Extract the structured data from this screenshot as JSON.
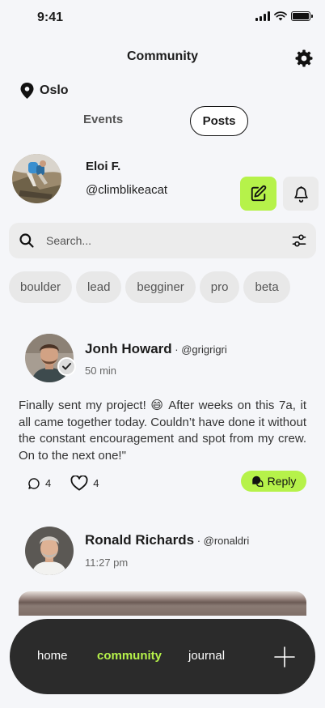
{
  "status": {
    "time": "9:41"
  },
  "header": {
    "title": "Community"
  },
  "location": {
    "city": "Oslo"
  },
  "tabs": {
    "events": "Events",
    "posts": "Posts",
    "active": "posts"
  },
  "profile": {
    "name": "Eloi F.",
    "handle": "@climblikeacat"
  },
  "search": {
    "placeholder": "Search..."
  },
  "chips": [
    "boulder",
    "lead",
    "begginer",
    "pro",
    "beta"
  ],
  "posts": [
    {
      "author": "Jonh Howard",
      "handle": "@grigrigri",
      "time": "50 min",
      "body": "Finally sent my project! 😄 After weeks on this 7a, it all came together today. Couldn’t have done it without the constant encouragement and spot from my crew. On to the next one!\"",
      "comments": "4",
      "likes": "4",
      "reply_label": "Reply"
    },
    {
      "author": "Ronald Richards",
      "handle": "@ronaldri",
      "time": "11:27 pm"
    }
  ],
  "nav": {
    "home": "home",
    "community": "community",
    "journal": "journal"
  },
  "colors": {
    "accent": "#b6f24a",
    "nav_bg": "#2b2b2b",
    "background": "#f5f6f9"
  }
}
